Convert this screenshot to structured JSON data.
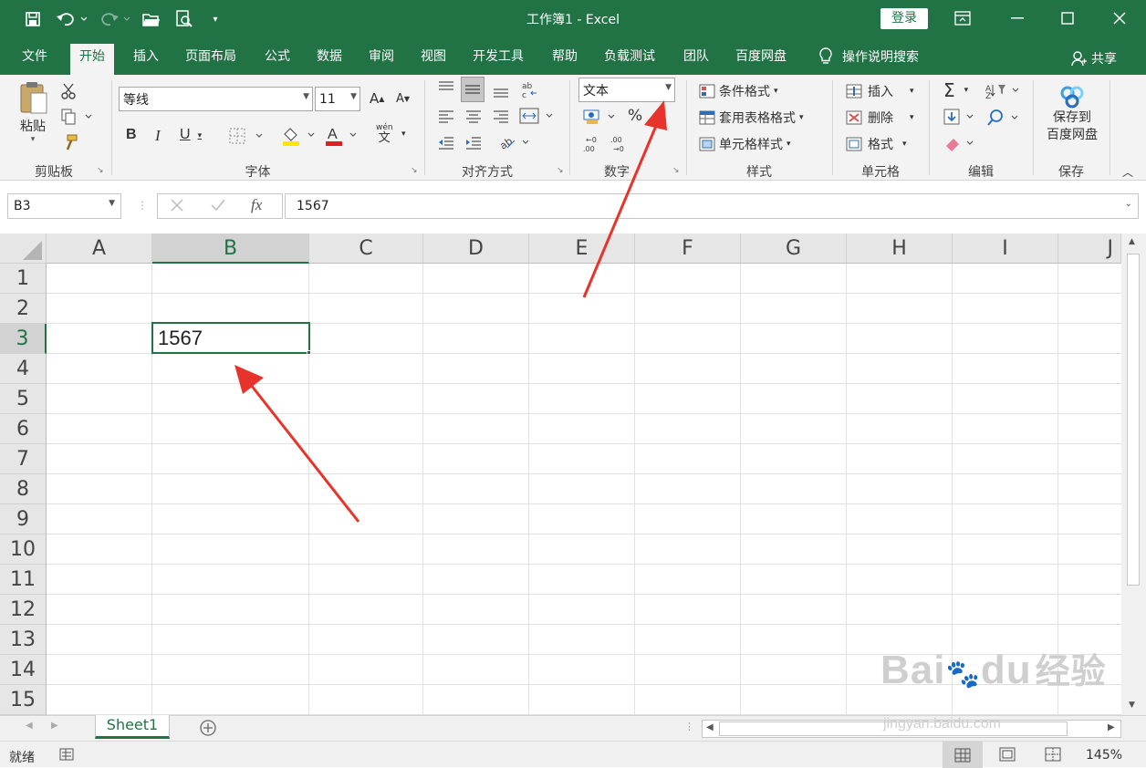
{
  "window": {
    "title": "工作簿1  -  Excel",
    "login_label": "登录"
  },
  "tabs": [
    "文件",
    "开始",
    "插入",
    "页面布局",
    "公式",
    "数据",
    "审阅",
    "视图",
    "开发工具",
    "帮助",
    "负载测试",
    "团队",
    "百度网盘"
  ],
  "tell_me": "操作说明搜索",
  "share_label": "共享",
  "ribbon": {
    "clipboard": {
      "paste": "粘贴",
      "label": "剪贴板"
    },
    "font": {
      "name": "等线",
      "size": "11",
      "label": "字体",
      "bold": "B",
      "italic": "I",
      "underline": "U",
      "grow": "A",
      "shrink": "A",
      "color_letter": "A",
      "phonetic_top": "wén",
      "phonetic_bottom": "文"
    },
    "alignment": {
      "label": "对齐方式"
    },
    "number": {
      "format": "文本",
      "label": "数字",
      "percent": "%"
    },
    "styles": {
      "conditional": "条件格式",
      "table": "套用表格格式",
      "cell": "单元格样式",
      "label": "样式"
    },
    "cells": {
      "insert": "插入",
      "delete": "删除",
      "format": "格式",
      "label": "单元格"
    },
    "editing": {
      "label": "编辑",
      "sigma": "Σ"
    },
    "save": {
      "line1": "保存到",
      "line2": "百度网盘",
      "label": "保存"
    }
  },
  "formula_bar": {
    "name_box": "B3",
    "fx": "fx",
    "content": "1567"
  },
  "columns": [
    "A",
    "B",
    "C",
    "D",
    "E",
    "F",
    "G",
    "H",
    "I",
    "J"
  ],
  "rows": [
    "1",
    "2",
    "3",
    "4",
    "5",
    "6",
    "7",
    "8",
    "9",
    "10",
    "11",
    "12",
    "13",
    "14",
    "15"
  ],
  "active_cell": {
    "ref": "B3",
    "value": "1567"
  },
  "sheets": [
    "Sheet1"
  ],
  "status": {
    "ready": "就绪",
    "zoom": "145%"
  },
  "watermark": {
    "brand": "Bai",
    "brand2": "du",
    "cn": "经验",
    "url": "jingyan.baidu.com"
  },
  "colors": {
    "excel_green": "#217346",
    "arrow_red": "#e8332c"
  }
}
